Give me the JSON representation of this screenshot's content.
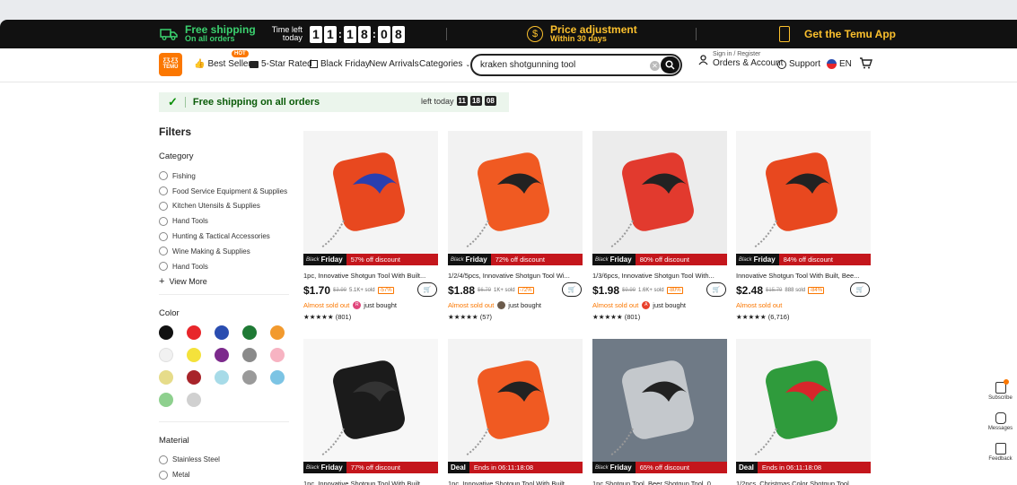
{
  "banner": {
    "free_shipping_title": "Free shipping",
    "free_shipping_sub": "On all orders",
    "time_left_1": "Time left",
    "time_left_2": "today",
    "countdown_digits": [
      "1",
      "1",
      "1",
      "8",
      "0",
      "8"
    ],
    "price_adj_title": "Price adjustment",
    "price_adj_sub": "Within 30 days",
    "get_app": "Get the Temu App",
    "icons": {
      "truck": "truck-icon",
      "dollar": "dollar-circle-icon",
      "phone": "phone-icon"
    }
  },
  "nav": {
    "logo_line1": "ƸƷ.ƸƷ",
    "logo_line2": "TEMU",
    "hot_badge": "HOT",
    "best_sellers": "Best Sellers",
    "five_star": "5-Star Rated",
    "black_friday": "Black Friday",
    "new_arrivals": "New Arrivals",
    "categories": "Categories",
    "search_value": "kraken shotgunning tool",
    "sign_in": "Sign in / Register",
    "orders_account": "Orders & Account",
    "support": "Support",
    "lang": "EN"
  },
  "shipbar": {
    "text": "Free shipping on all orders",
    "left_today": "left today",
    "hh": "11",
    "mm": "18",
    "ss": "08"
  },
  "filters": {
    "title": "Filters",
    "category_title": "Category",
    "categories": [
      "Fishing",
      "Food Service Equipment & Supplies",
      "Kitchen Utensils & Supplies",
      "Hand Tools",
      "Hunting & Tactical Accessories",
      "Wine Making & Supplies",
      "Hand Tools"
    ],
    "view_more": "View More",
    "color_title": "Color",
    "colors": [
      "#111111",
      "#e8262b",
      "#2a4db0",
      "#1f7a35",
      "#f29a2e",
      "#f1f1f1",
      "#f4e23b",
      "#7c2a8c",
      "#8a8a8a",
      "#f7b3c2",
      "#e6dc8a",
      "#a8242a",
      "#a7dbe8",
      "#9a9a9a",
      "#7cc4e4",
      "#8ed08e",
      "#d0d0d0"
    ],
    "material_title": "Material",
    "materials": [
      "Stainless Steel",
      "Metal"
    ]
  },
  "products": [
    {
      "tag_label": "Black",
      "tag_bold": "Friday",
      "discount": "57% off discount",
      "title": "1pc, Innovative Shotgun Tool With Built...",
      "price": "$1.70",
      "old": "$3.99",
      "sold": "5.1K+ sold",
      "pct": "-57%",
      "almost": "Almost sold out",
      "bought": "just bought",
      "bought_initial": "R",
      "bought_color": "#e0457b",
      "rating": "★★★★★ (801)"
    },
    {
      "tag_label": "Black",
      "tag_bold": "Friday",
      "discount": "72% off discount",
      "title": "1/2/4/5pcs, Innovative Shotgun Tool Wi...",
      "price": "$1.88",
      "old": "$6.79",
      "sold": "1K+ sold",
      "pct": "-72%",
      "almost": "Almost sold out",
      "bought": "just bought",
      "bought_initial": "",
      "bought_color": "#6b5b4b",
      "rating": "★★★★★ (57)"
    },
    {
      "tag_label": "Black",
      "tag_bold": "Friday",
      "discount": "80% off discount",
      "title": "1/3/6pcs, Innovative Shotgun Tool With...",
      "price": "$1.98",
      "old": "$9.99",
      "sold": "1.6K+ sold",
      "pct": "-80%",
      "almost": "Almost sold out",
      "bought": "just bought",
      "bought_initial": "A",
      "bought_color": "#e8402b",
      "rating": "★★★★★ (801)"
    },
    {
      "tag_label": "Black",
      "tag_bold": "Friday",
      "discount": "84% off discount",
      "title": "Innovative Shotgun Tool With Built, Bee...",
      "price": "$2.48",
      "old": "$15.79",
      "sold": "888 sold",
      "pct": "-84%",
      "almost": "Almost sold out",
      "bought": "",
      "bought_initial": "",
      "bought_color": "",
      "rating": "★★★★★ (6,716)"
    },
    {
      "tag_label": "Black",
      "tag_bold": "Friday",
      "discount": "77% off discount",
      "title": "1pc, Innovative Shotgun Tool With Built...",
      "price": "",
      "old": "",
      "sold": "",
      "pct": "",
      "almost": "",
      "bought": "",
      "rating": ""
    },
    {
      "tag_label": "",
      "tag_bold": "Deal",
      "discount": "Ends in 06:11:18:08",
      "title": "1pc, Innovative Shotgun Tool With Built...",
      "price": "",
      "old": "",
      "sold": "",
      "pct": "",
      "almost": "",
      "bought": "",
      "rating": ""
    },
    {
      "tag_label": "Black",
      "tag_bold": "Friday",
      "discount": "65% off discount",
      "title": "1pc Shotgun Tool, Beer Shotgun Tool, 0...",
      "price": "",
      "old": "",
      "sold": "",
      "pct": "",
      "almost": "",
      "bought": "",
      "rating": ""
    },
    {
      "tag_label": "",
      "tag_bold": "Deal",
      "discount": "Ends in 06:11:18:08",
      "title": "1/2pcs, Christmas Color Shotgun Tool...",
      "price": "",
      "old": "",
      "sold": "",
      "pct": "",
      "almost": "",
      "bought": "",
      "rating": ""
    }
  ],
  "rail": {
    "subscribe": "Subscribe",
    "messages": "Messages",
    "feedback": "Feedback"
  }
}
